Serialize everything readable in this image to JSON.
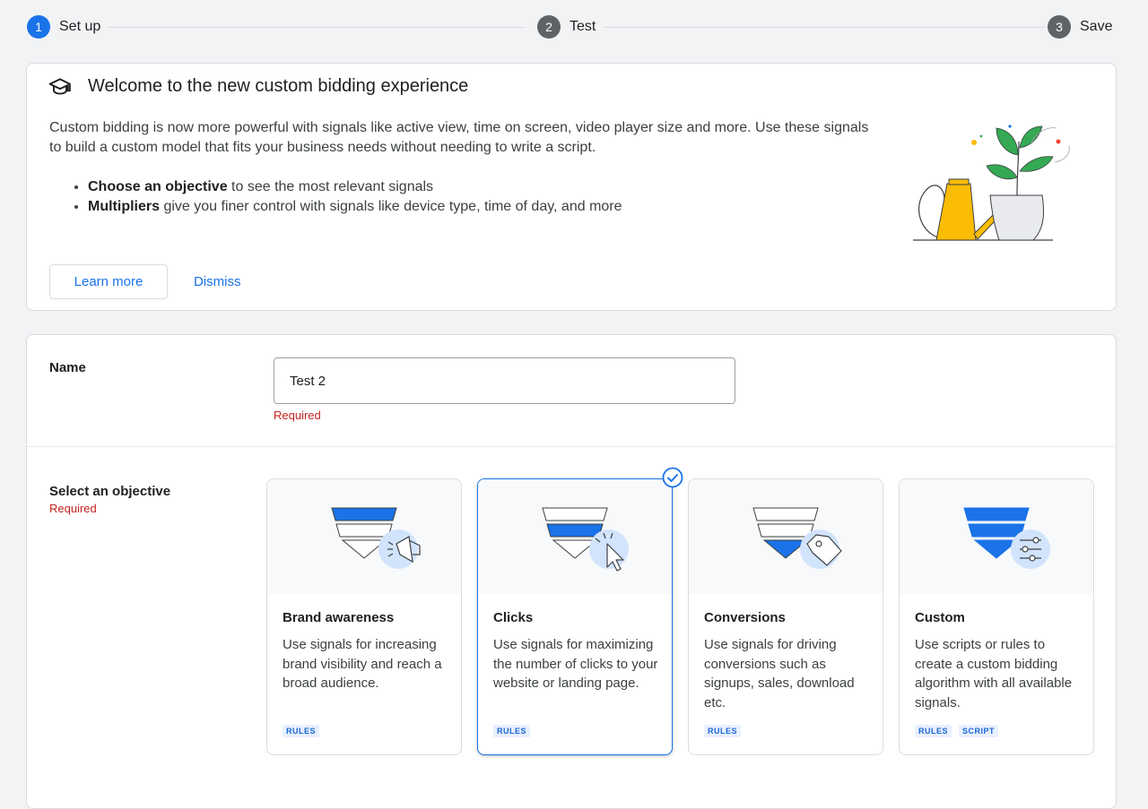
{
  "stepper": {
    "steps": [
      {
        "number": "1",
        "label": "Set up",
        "state": "active"
      },
      {
        "number": "2",
        "label": "Test",
        "state": "inactive"
      },
      {
        "number": "3",
        "label": "Save",
        "state": "inactive"
      }
    ]
  },
  "welcome": {
    "icon": "graduation-cap-icon",
    "title": "Welcome to the new custom bidding experience",
    "description": "Custom bidding is now more powerful with signals like active view, time on screen, video player size and more. Use these signals to build a custom model that fits your business needs without needing to write a script.",
    "bullets": [
      {
        "bold": "Choose an objective",
        "rest": " to see the most relevant signals"
      },
      {
        "bold": "Multipliers",
        "rest": " give you finer control with signals like device type, time of day, and more"
      }
    ],
    "learn_more_label": "Learn more",
    "dismiss_label": "Dismiss"
  },
  "form": {
    "name_label": "Name",
    "name_value": "Test 2",
    "name_required": "Required",
    "objective_label": "Select an objective",
    "objective_required": "Required",
    "objectives": [
      {
        "title": "Brand awareness",
        "description": "Use signals for increasing brand visibility and reach a broad audience.",
        "chips": [
          "RULES"
        ],
        "icon": "megaphone-icon",
        "selected": false
      },
      {
        "title": "Clicks",
        "description": "Use signals for maximizing the number of clicks to your website or landing page.",
        "chips": [
          "RULES"
        ],
        "icon": "cursor-click-icon",
        "selected": true
      },
      {
        "title": "Conversions",
        "description": "Use signals for driving conversions such as signups, sales, download etc.",
        "chips": [
          "RULES"
        ],
        "icon": "price-tag-icon",
        "selected": false
      },
      {
        "title": "Custom",
        "description": "Use scripts or rules to create a custom bidding algorithm with all available signals.",
        "chips": [
          "RULES",
          "SCRIPT"
        ],
        "icon": "sliders-icon",
        "selected": false
      }
    ]
  },
  "colors": {
    "accent": "#1a73e8",
    "required": "#c5221f",
    "funnel_blue": "#1a73e8",
    "icon_circle": "#d2e3fc"
  }
}
